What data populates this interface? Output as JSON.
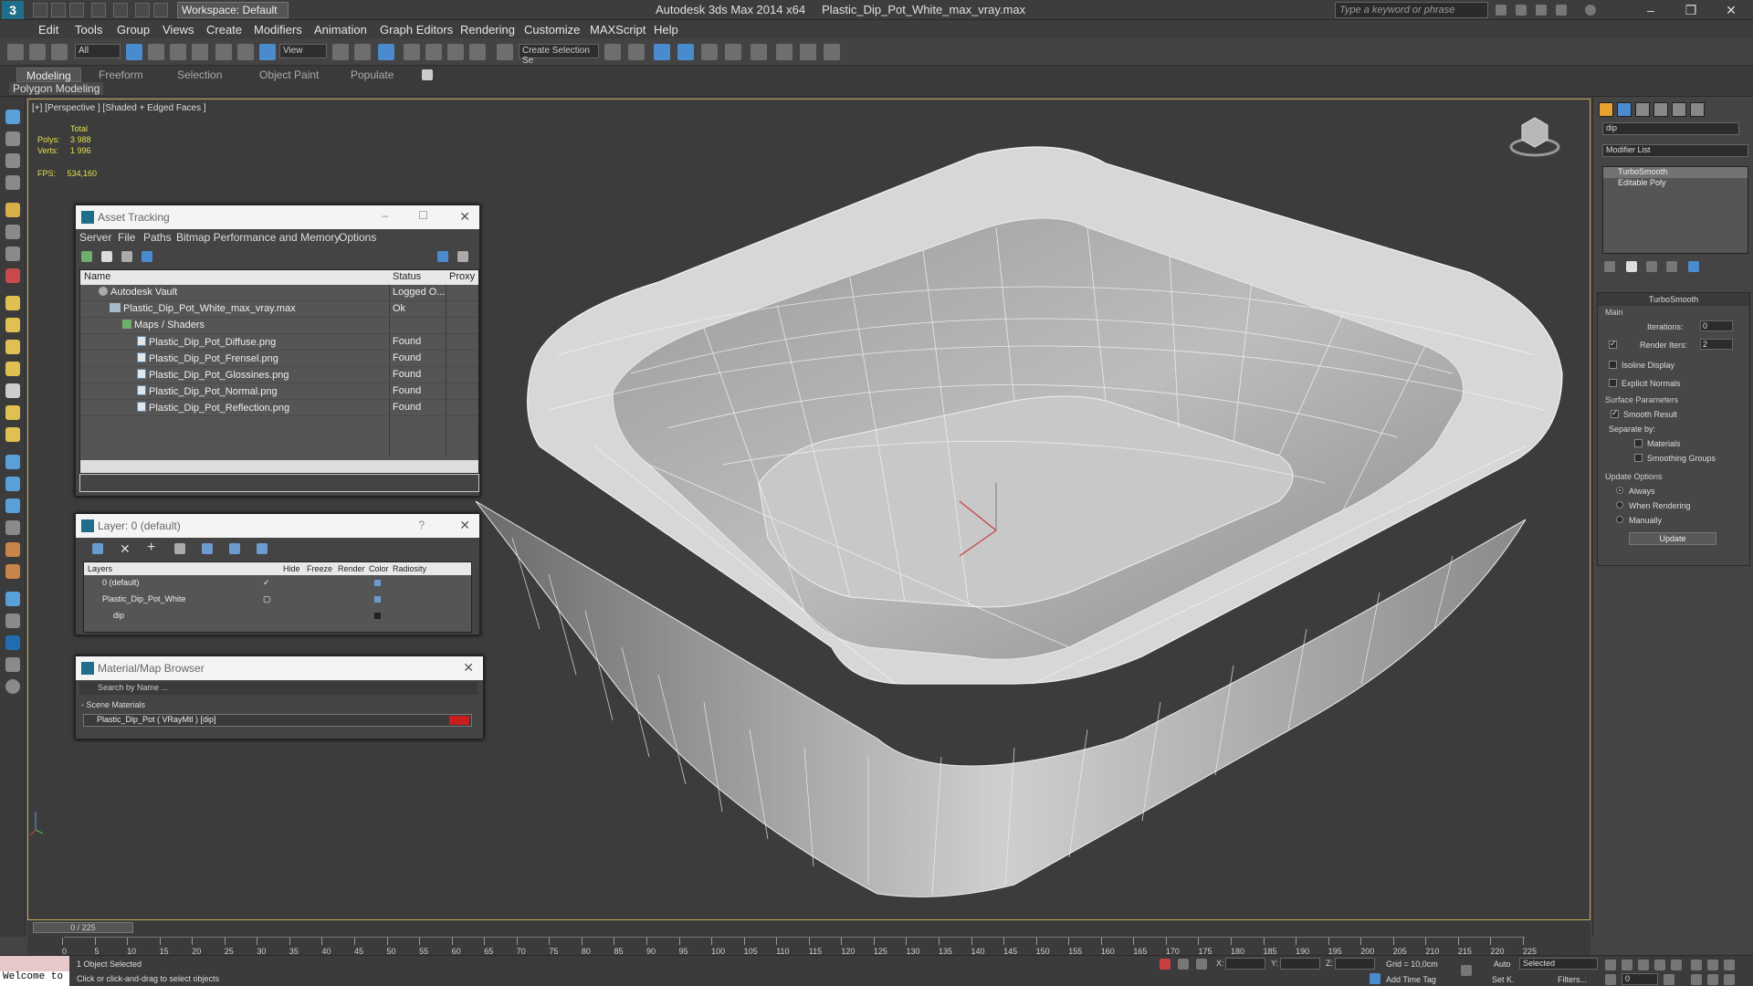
{
  "app": {
    "name": "Autodesk 3ds Max  2014 x64",
    "file": "Plastic_Dip_Pot_White_max_vray.max",
    "workspace": "Workspace: Default",
    "search_placeholder": "Type a keyword or phrase"
  },
  "menu": [
    "Edit",
    "Tools",
    "Group",
    "Views",
    "Create",
    "Modifiers",
    "Animation",
    "Graph Editors",
    "Rendering",
    "Customize",
    "MAXScript",
    "Help"
  ],
  "toolbar": {
    "selection_filter": "All",
    "ref_coord": "View",
    "named_selection": "Create Selection Se"
  },
  "ribbon": {
    "tabs": [
      "Modeling",
      "Freeform",
      "Selection",
      "Object Paint",
      "Populate"
    ],
    "active_tab": "Modeling",
    "subpanel": "Polygon Modeling"
  },
  "viewport": {
    "label": "[+] [Perspective ] [Shaded + Edged Faces ]",
    "stats_header": "Total",
    "polys_label": "Polys:",
    "polys_value": "3 988",
    "verts_label": "Verts:",
    "verts_value": "1 996",
    "fps_label": "FPS:",
    "fps_value": "534,160"
  },
  "asset_tracking": {
    "title": "Asset Tracking",
    "menu": [
      "Server",
      "File",
      "Paths",
      "Bitmap Performance and Memory",
      "Options"
    ],
    "columns": [
      "Name",
      "Status",
      "Proxy"
    ],
    "rows": [
      {
        "name": "Autodesk Vault",
        "status": "Logged O..."
      },
      {
        "name": "Plastic_Dip_Pot_White_max_vray.max",
        "status": "Ok"
      },
      {
        "name": "Maps / Shaders",
        "status": ""
      },
      {
        "name": "Plastic_Dip_Pot_Diffuse.png",
        "status": "Found"
      },
      {
        "name": "Plastic_Dip_Pot_Frensel.png",
        "status": "Found"
      },
      {
        "name": "Plastic_Dip_Pot_Glossines.png",
        "status": "Found"
      },
      {
        "name": "Plastic_Dip_Pot_Normal.png",
        "status": "Found"
      },
      {
        "name": "Plastic_Dip_Pot_Reflection.png",
        "status": "Found"
      }
    ]
  },
  "layer_panel": {
    "title": "Layer: 0 (default)",
    "help": "?",
    "columns": [
      "Layers",
      "Hide",
      "Freeze",
      "Render",
      "Color",
      "Radiosity"
    ],
    "rows": [
      "0 (default)",
      "Plastic_Dip_Pot_White",
      "dip"
    ]
  },
  "material_browser": {
    "title": "Material/Map Browser",
    "search_placeholder": "Search by Name ...",
    "group": "- Scene Materials",
    "material": "Plastic_Dip_Pot  ( VRayMtl ) [dip]",
    "accent": "#c81e1e"
  },
  "command_panel": {
    "object_name": "dip",
    "modifier_list": "Modifier List",
    "stack": [
      "TurboSmooth",
      "Editable Poly"
    ],
    "turbosmooth": {
      "title": "TurboSmooth",
      "main": "Main",
      "iterations_label": "Iterations:",
      "iterations": "0",
      "render_iters_label": "Render Iters:",
      "render_iters": "2",
      "isoline": "Isoline Display",
      "explicit_normals": "Explicit Normals",
      "surface_params": "Surface Parameters",
      "smooth_result": "Smooth Result",
      "separate_by": "Separate by:",
      "materials": "Materials",
      "smoothing_groups": "Smoothing Groups",
      "update_options": "Update Options",
      "always": "Always",
      "when_rendering": "When Rendering",
      "manually": "Manually",
      "update": "Update"
    }
  },
  "timeline": {
    "frame": "0 / 225",
    "ticks": [
      "0",
      "5",
      "10",
      "15",
      "20",
      "25",
      "30",
      "35",
      "40",
      "45",
      "50",
      "55",
      "60",
      "65",
      "70",
      "75",
      "80",
      "85",
      "90",
      "95",
      "100",
      "105",
      "110",
      "115",
      "120",
      "125",
      "130",
      "135",
      "140",
      "145",
      "150",
      "155",
      "160",
      "165",
      "170",
      "175",
      "180",
      "185",
      "190",
      "195",
      "200",
      "205",
      "210",
      "215",
      "220",
      "225"
    ]
  },
  "status": {
    "maxscript": "Welcome to",
    "selected": "1 Object Selected",
    "prompt": "Click or click-and-drag to select objects",
    "x_label": "X:",
    "y_label": "Y:",
    "z_label": "Z:",
    "grid": "Grid = 10,0cm",
    "add_time_tag": "Add Time Tag",
    "auto": "Auto",
    "set_k": "Set K.",
    "key_filter": "Selected",
    "filters": "Filters...",
    "frame_field": "0"
  }
}
